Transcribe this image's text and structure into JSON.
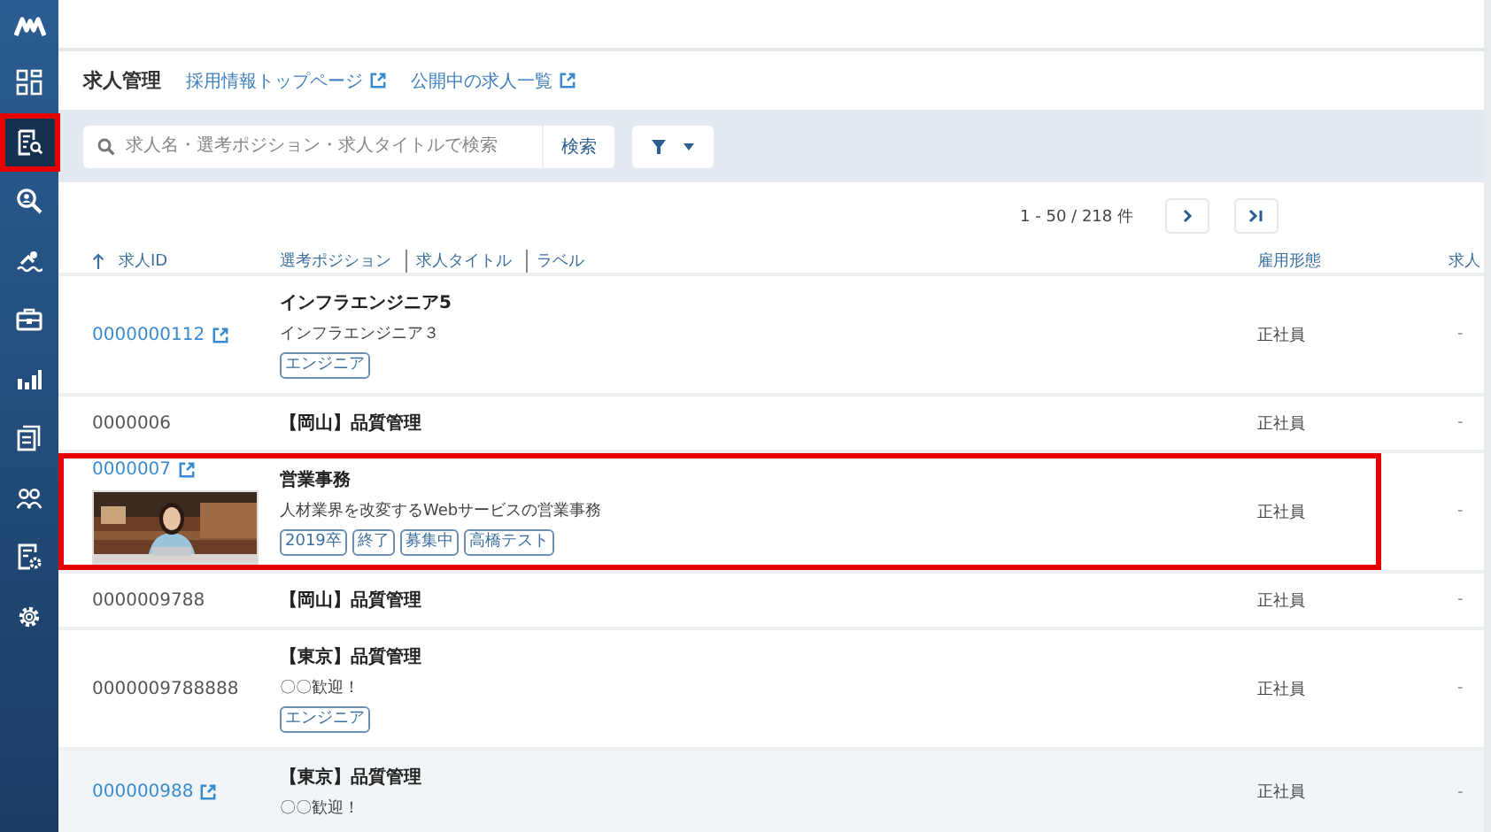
{
  "sidebar": {
    "items": [
      {
        "kind": "dashboard",
        "selected": false,
        "highlighted": false
      },
      {
        "kind": "jobs",
        "selected": true,
        "highlighted": true
      },
      {
        "kind": "search-person",
        "selected": false,
        "highlighted": false
      },
      {
        "kind": "swimmer",
        "selected": false,
        "highlighted": false
      },
      {
        "kind": "briefcase",
        "selected": false,
        "highlighted": false
      },
      {
        "kind": "chart",
        "selected": false,
        "highlighted": false
      },
      {
        "kind": "documents",
        "selected": false,
        "highlighted": false
      },
      {
        "kind": "people",
        "selected": false,
        "highlighted": false
      },
      {
        "kind": "doc-gear",
        "selected": false,
        "highlighted": false
      },
      {
        "kind": "gear",
        "selected": false,
        "highlighted": false
      }
    ]
  },
  "header": {
    "title": "求人管理",
    "links": [
      "採用情報トップページ",
      "公開中の求人一覧"
    ]
  },
  "search": {
    "placeholder": "求人名・選考ポジション・求人タイトルで検索",
    "button": "検索"
  },
  "pager": {
    "range": "1 - 50 / 218 件"
  },
  "table": {
    "columns": [
      {
        "labels": [
          "求人ID"
        ],
        "sorted": true
      },
      {
        "labels": [
          "選考ポジション",
          "求人タイトル",
          "ラベル"
        ],
        "sorted": false
      },
      {
        "labels": [
          "雇用形態"
        ],
        "sorted": false
      },
      {
        "labels": [
          "求人"
        ],
        "sorted": false
      }
    ],
    "rows": [
      {
        "id": "0000000112",
        "linked": true,
        "title": "インフラエンジニア5",
        "subtitle": "インフラエンジニア３",
        "labels": [
          "エンジニア"
        ],
        "employment": "正社員",
        "column_4": "-",
        "highlighted": false,
        "hovered": false
      },
      {
        "id": "0000006",
        "linked": false,
        "title": "【岡山】品質管理",
        "labels": [],
        "employment": "正社員",
        "column_4": "-",
        "highlighted": false,
        "hovered": false
      },
      {
        "id": "0000007",
        "linked": true,
        "title": "営業事務",
        "subtitle": "人材業界を改変するWebサービスの営業事務",
        "labels": [
          "2019卒",
          "終了",
          "募集中",
          "高橋テスト"
        ],
        "employment": "正社員",
        "column_4": "-",
        "highlighted": true,
        "hovered": false
      },
      {
        "id": "0000009788",
        "linked": false,
        "title": "【岡山】品質管理",
        "labels": [],
        "employment": "正社員",
        "column_4": "-",
        "highlighted": false,
        "hovered": false
      },
      {
        "id": "0000009788888",
        "linked": false,
        "title": "【東京】品質管理",
        "subtitle": "〇〇歓迎！",
        "labels": [
          "エンジニア"
        ],
        "employment": "正社員",
        "column_4": "-",
        "highlighted": false,
        "hovered": false
      },
      {
        "id": "000000988",
        "linked": true,
        "title": "【東京】品質管理",
        "subtitle": "〇〇歓迎！",
        "labels": [],
        "employment": "正社員",
        "column_4": "-",
        "highlighted": false,
        "hovered": true
      }
    ]
  }
}
